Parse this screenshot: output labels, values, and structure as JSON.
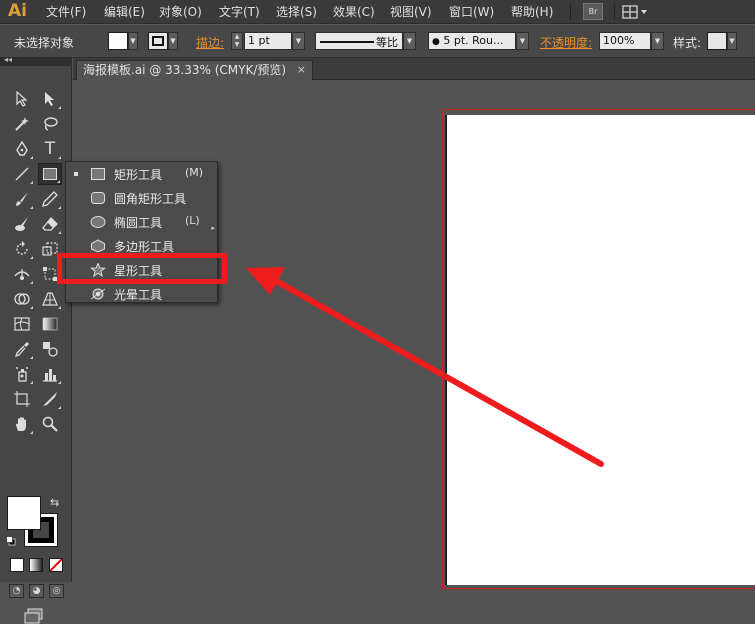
{
  "menubar": {
    "logo": "Ai",
    "items": [
      "文件(F)",
      "编辑(E)",
      "对象(O)",
      "文字(T)",
      "选择(S)",
      "效果(C)",
      "视图(V)",
      "窗口(W)",
      "帮助(H)"
    ],
    "bridge_label": "Br"
  },
  "controlbar": {
    "selection_status": "未选择对象",
    "stroke_label": "描边:",
    "stroke_weight": "1 pt",
    "stroke_profile": "等比",
    "brush_definition": "5 pt. Rou...",
    "opacity_label": "不透明度:",
    "opacity_value": "100%",
    "style_label": "样式:"
  },
  "document_tab": {
    "title": "海报模板.ai @ 33.33% (CMYK/预览)",
    "close": "×"
  },
  "tools": {
    "fill_color": "#ffffff",
    "stroke_color": "#000000",
    "collapse_glyph": "◂◂"
  },
  "flyout": {
    "items": [
      {
        "label": "矩形工具",
        "key": "(M)",
        "icon": "rectangle-icon",
        "selected": true
      },
      {
        "label": "圆角矩形工具",
        "key": "",
        "icon": "rounded-rectangle-icon",
        "selected": false
      },
      {
        "label": "椭圆工具",
        "key": "(L)",
        "icon": "ellipse-icon",
        "selected": false
      },
      {
        "label": "多边形工具",
        "key": "",
        "icon": "polygon-icon",
        "selected": false
      },
      {
        "label": "星形工具",
        "key": "",
        "icon": "star-icon",
        "selected": false
      },
      {
        "label": "光晕工具",
        "key": "",
        "icon": "flare-icon",
        "selected": false
      }
    ],
    "tearoff": "▸"
  },
  "colors": {
    "highlight": "#ee1c1c",
    "artboard_border": "#cc2222",
    "accent_orange": "#e8902e"
  }
}
